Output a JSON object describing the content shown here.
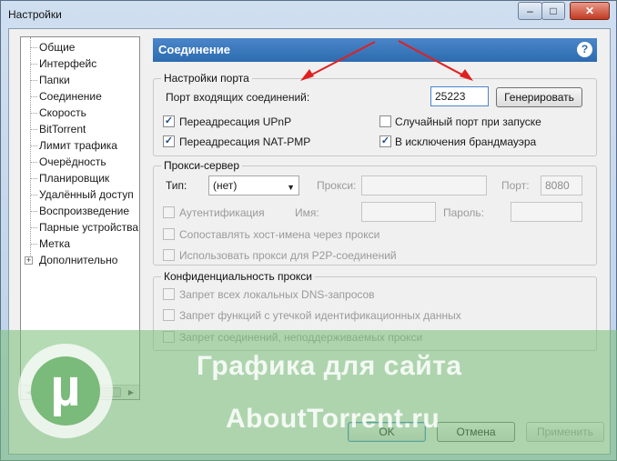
{
  "window": {
    "title": "Настройки",
    "min_label": "–",
    "max_label": "□",
    "close_label": "✕"
  },
  "tree": {
    "items": [
      {
        "label": "Общие"
      },
      {
        "label": "Интерфейс"
      },
      {
        "label": "Папки"
      },
      {
        "label": "Соединение"
      },
      {
        "label": "Скорость"
      },
      {
        "label": "BitTorrent"
      },
      {
        "label": "Лимит трафика"
      },
      {
        "label": "Очерёдность"
      },
      {
        "label": "Планировщик"
      },
      {
        "label": "Удалённый доступ"
      },
      {
        "label": "Воспроизведение"
      },
      {
        "label": "Парные устройства"
      },
      {
        "label": "Метка"
      },
      {
        "label": "Дополнительно"
      }
    ],
    "expander_label": "+",
    "scroll_left": "◀",
    "scroll_right": "▶"
  },
  "panel": {
    "title": "Соединение",
    "help": "?"
  },
  "port": {
    "group_title": "Настройки порта",
    "incoming_label": "Порт входящих соединений:",
    "port_value": "25223",
    "generate_label": "Генерировать",
    "upnp_label": "Переадресация UPnP",
    "upnp_checked": "✓",
    "natpmp_label": "Переадресация NAT-PMP",
    "natpmp_checked": "✓",
    "random_label": "Случайный порт при запуске",
    "firewall_label": "В исключения брандмауэра",
    "firewall_checked": "✓"
  },
  "proxy": {
    "group_title": "Прокси-сервер",
    "type_label": "Тип:",
    "type_value": "(нет)",
    "proxy_label": "Прокси:",
    "port_label": "Порт:",
    "port_value": "8080",
    "auth_label": "Аутентификация",
    "name_label": "Имя:",
    "password_label": "Пароль:",
    "resolve_label": "Сопоставлять хост-имена через прокси",
    "p2p_label": "Использовать прокси для P2P-соединений"
  },
  "privacy": {
    "group_title": "Конфиденциальность прокси",
    "dns_label": "Запрет всех локальных DNS-запросов",
    "leak_label": "Запрет функций с утечкой идентификационных данных",
    "unsupported_label": "Запрет соединений, неподдерживаемых прокси"
  },
  "buttons": {
    "ok": "OK",
    "cancel": "Отмена",
    "apply": "Применить"
  },
  "watermark": {
    "line1": "Графика для сайта",
    "line2": "AboutTorrent.ru",
    "logo_glyph": "µ"
  },
  "colors": {
    "header_blue": "#2d6bb0",
    "annotation_red": "#e02020",
    "watermark_green": "#78be78"
  }
}
